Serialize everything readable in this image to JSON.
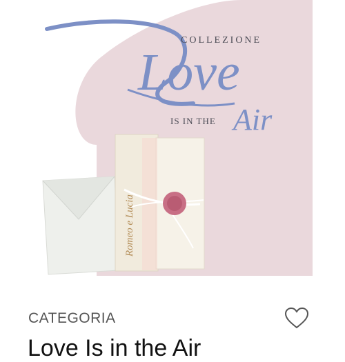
{
  "product": {
    "image": {
      "collection_word": "COLLEZIONE",
      "logo_main": "Love",
      "logo_small": "IS IN THE",
      "logo_end": "Air",
      "card_names": "Romeo e Lucia"
    },
    "category_label": "CATEGORIA",
    "title": "Love Is in the Air",
    "wishlist_icon": "heart-outline-icon",
    "colors": {
      "blob": "#ead8dc",
      "logo": "#7d90c6",
      "card": "#f4efe3",
      "envelope": "#eef0ec",
      "seal": "#c86f85",
      "text_dark": "#111111",
      "text_muted": "#555555"
    }
  }
}
